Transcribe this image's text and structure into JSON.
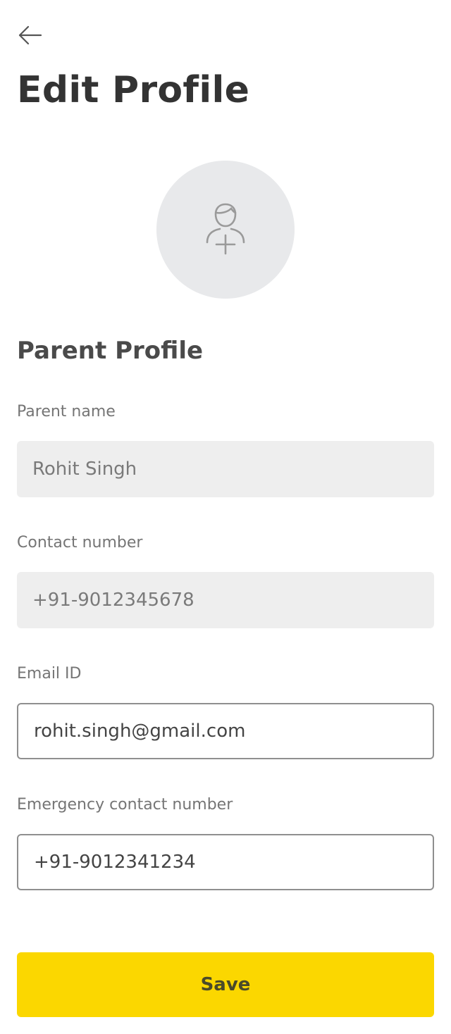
{
  "header": {
    "back_icon": "arrow-left-icon",
    "title": "Edit Profile"
  },
  "avatar": {
    "icon": "add-user-icon"
  },
  "section": {
    "title": "Parent Profile"
  },
  "fields": {
    "parent_name": {
      "label": "Parent name",
      "value": "Rohit Singh"
    },
    "contact_number": {
      "label": "Contact number",
      "value": "+91-9012345678"
    },
    "email": {
      "label": "Email ID",
      "value": "rohit.singh@gmail.com"
    },
    "emergency_contact": {
      "label": "Emergency contact number",
      "value": "+91-9012341234"
    }
  },
  "actions": {
    "save_label": "Save"
  },
  "colors": {
    "accent": "#fbd700",
    "disabled_field_bg": "#eeeeee",
    "avatar_bg": "#e8e9eb"
  }
}
